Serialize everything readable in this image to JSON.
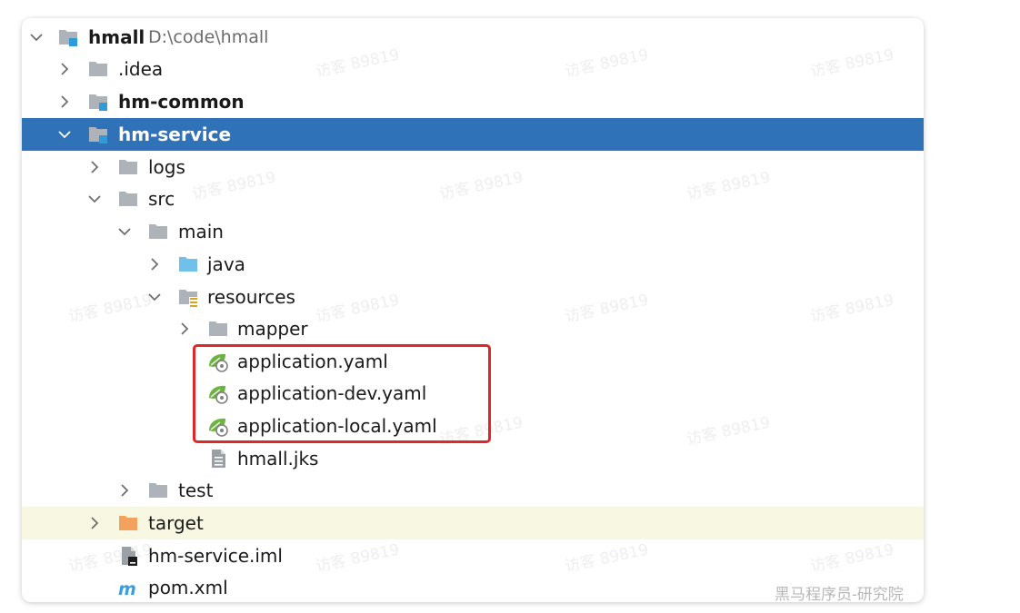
{
  "tree": {
    "root": {
      "name": "hmall",
      "path": "D:\\code\\hmall"
    },
    "idea": ".idea",
    "hm_common": "hm-common",
    "hm_service": "hm-service",
    "logs": "logs",
    "src": "src",
    "main": "main",
    "java": "java",
    "resources": "resources",
    "mapper": "mapper",
    "app_yaml": "application.yaml",
    "app_dev_yaml": "application-dev.yaml",
    "app_local_yaml": "application-local.yaml",
    "hmall_jks": "hmall.jks",
    "test": "test",
    "target": "target",
    "hm_service_iml": "hm-service.iml",
    "pom_xml": "pom.xml"
  },
  "watermark": "访客 89819",
  "footer_watermark": "黑马程序员-研究院",
  "colors": {
    "selection": "#2f72b7",
    "excluded_row": "#f8f8e2",
    "highlight_border": "#e0262a",
    "folder_gray": "#aeb3b9",
    "folder_blue": "#6fc0ea",
    "folder_orange": "#f4a15d",
    "module_marker": "#2f9bd9",
    "spring_green": "#6db33f"
  },
  "icons": {
    "folder": "folder-icon",
    "module": "module-folder-icon",
    "source_root": "source-folder-icon",
    "resources_root": "resources-folder-icon",
    "excluded": "excluded-folder-icon",
    "spring_config": "spring-config-icon",
    "text_file": "text-file-icon",
    "iml": "iml-file-icon",
    "maven": "maven-icon"
  }
}
